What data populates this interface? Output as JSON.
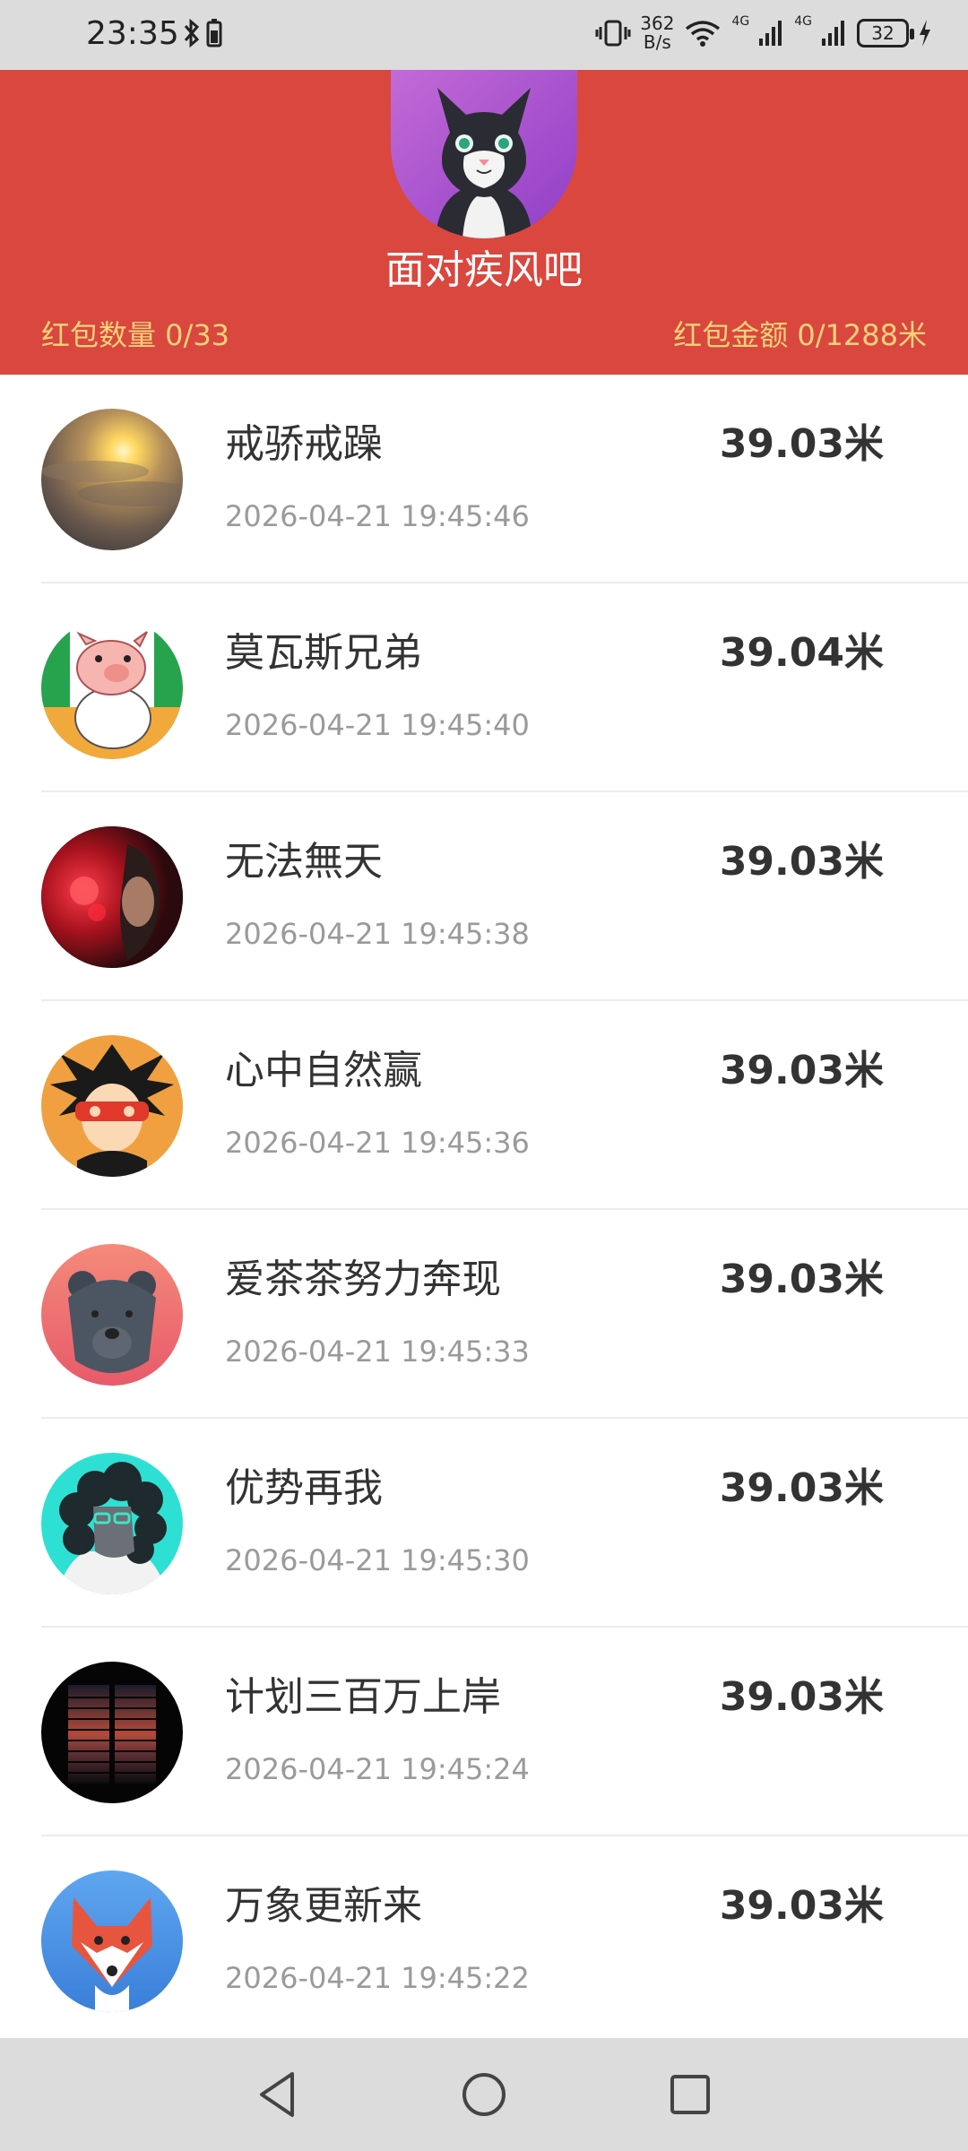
{
  "status_bar": {
    "time": "23:35",
    "net_speed_value": "362",
    "net_speed_unit": "B/s",
    "sim1": "4G",
    "sim2": "4G",
    "battery": "32"
  },
  "header": {
    "host_name": "面对疾风吧",
    "count_text": "红包数量 0/33",
    "amount_text": "红包金额 0/1288米",
    "background_color": "#d9473e",
    "accent_text_color": "#f6d27a"
  },
  "list": [
    {
      "name": "戒骄戒躁",
      "time": "2026-04-21 19:45:46",
      "amount": "39.03米",
      "avatar_icon": "sunset-sky-avatar"
    },
    {
      "name": "莫瓦斯兄弟",
      "time": "2026-04-21 19:45:40",
      "amount": "39.04米",
      "avatar_icon": "cartoon-pig-avatar"
    },
    {
      "name": "无法無天",
      "time": "2026-04-21 19:45:38",
      "amount": "39.03米",
      "avatar_icon": "dark-red-flower-avatar"
    },
    {
      "name": "心中自然赢",
      "time": "2026-04-21 19:45:36",
      "amount": "39.03米",
      "avatar_icon": "anime-boy-avatar"
    },
    {
      "name": "爱茶茶努力奔现",
      "time": "2026-04-21 19:45:33",
      "amount": "39.03米",
      "avatar_icon": "bear-avatar"
    },
    {
      "name": "优势再我",
      "time": "2026-04-21 19:45:30",
      "amount": "39.03米",
      "avatar_icon": "curly-hair-person-avatar"
    },
    {
      "name": "计划三百万上岸",
      "time": "2026-04-21 19:45:24",
      "amount": "39.03米",
      "avatar_icon": "window-sunset-avatar"
    },
    {
      "name": "万象更新来",
      "time": "2026-04-21 19:45:22",
      "amount": "39.03米",
      "avatar_icon": "fox-avatar"
    }
  ],
  "nav_bar": {
    "back_icon": "back-triangle-icon",
    "home_icon": "home-circle-icon",
    "recents_icon": "recents-square-icon"
  }
}
